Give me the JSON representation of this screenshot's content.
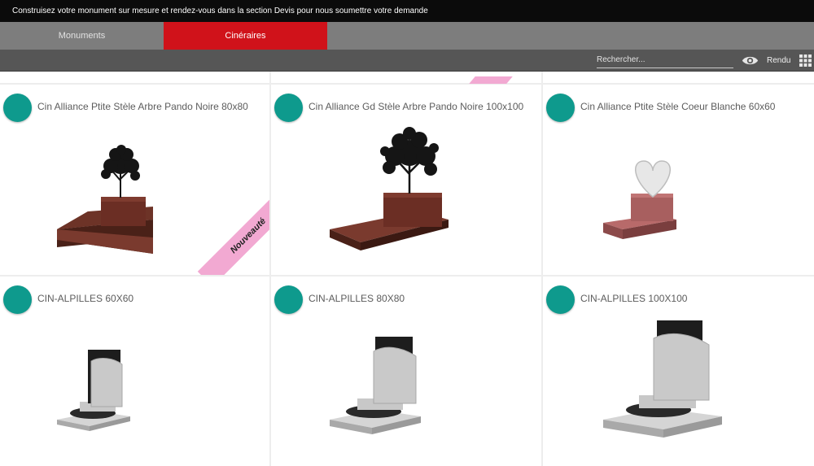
{
  "banner": {
    "text": "Construisez votre monument sur mesure et rendez-vous dans la section Devis pour nous soumettre votre demande"
  },
  "tabs": [
    {
      "label": "Monuments",
      "active": false
    },
    {
      "label": "Cinéraires",
      "active": true
    }
  ],
  "toolbar": {
    "search_placeholder": "Rechercher...",
    "view_icon": "eye-icon",
    "render_label": "Rendu",
    "grid_icon": "grid-icon"
  },
  "colors": {
    "accent_red": "#d0121a",
    "teal": "#0e9a8d",
    "ribbon_pink": "#f2a9d2"
  },
  "products": [
    {
      "title": "Cin Alliance Ptite Stèle Arbre Pando Noire 80x80",
      "badge": "Nouveauté"
    },
    {
      "title": "Cin Alliance Gd Stèle Arbre Pando Noire 100x100"
    },
    {
      "title": "Cin Alliance Ptite Stèle Coeur Blanche 60x60"
    },
    {
      "title": "CIN-ALPILLES 60X60"
    },
    {
      "title": "CIN-ALPILLES 80X80"
    },
    {
      "title": "CIN-ALPILLES 100X100"
    }
  ]
}
